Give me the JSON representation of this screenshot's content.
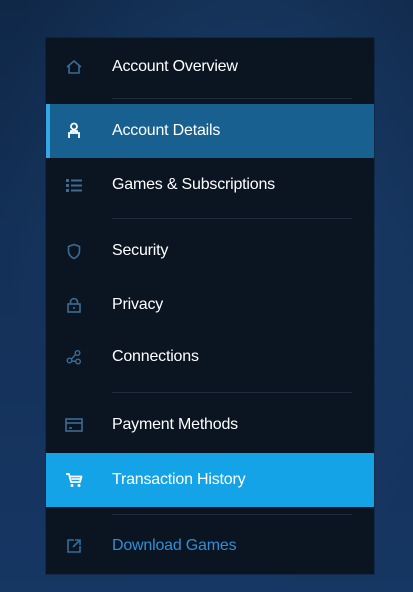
{
  "nav": {
    "items": [
      {
        "label": "Account Overview",
        "icon": "home-icon"
      },
      {
        "label": "Account Details",
        "icon": "user-icon",
        "state": "active"
      },
      {
        "label": "Games & Subscriptions",
        "icon": "list-icon"
      },
      {
        "label": "Security",
        "icon": "shield-icon"
      },
      {
        "label": "Privacy",
        "icon": "lock-icon"
      },
      {
        "label": "Connections",
        "icon": "share-icon"
      },
      {
        "label": "Payment Methods",
        "icon": "credit-card-icon"
      },
      {
        "label": "Transaction History",
        "icon": "cart-icon",
        "state": "selected"
      },
      {
        "label": "Download Games",
        "icon": "external-link-icon"
      }
    ]
  },
  "colors": {
    "sidebar_bg": "#0b1421",
    "active_bg": "#17608f",
    "active_accent": "#34a7e8",
    "selected_bg": "#14a3e6",
    "link_color": "#2f8fd8",
    "icon_muted": "#3d6c93"
  }
}
